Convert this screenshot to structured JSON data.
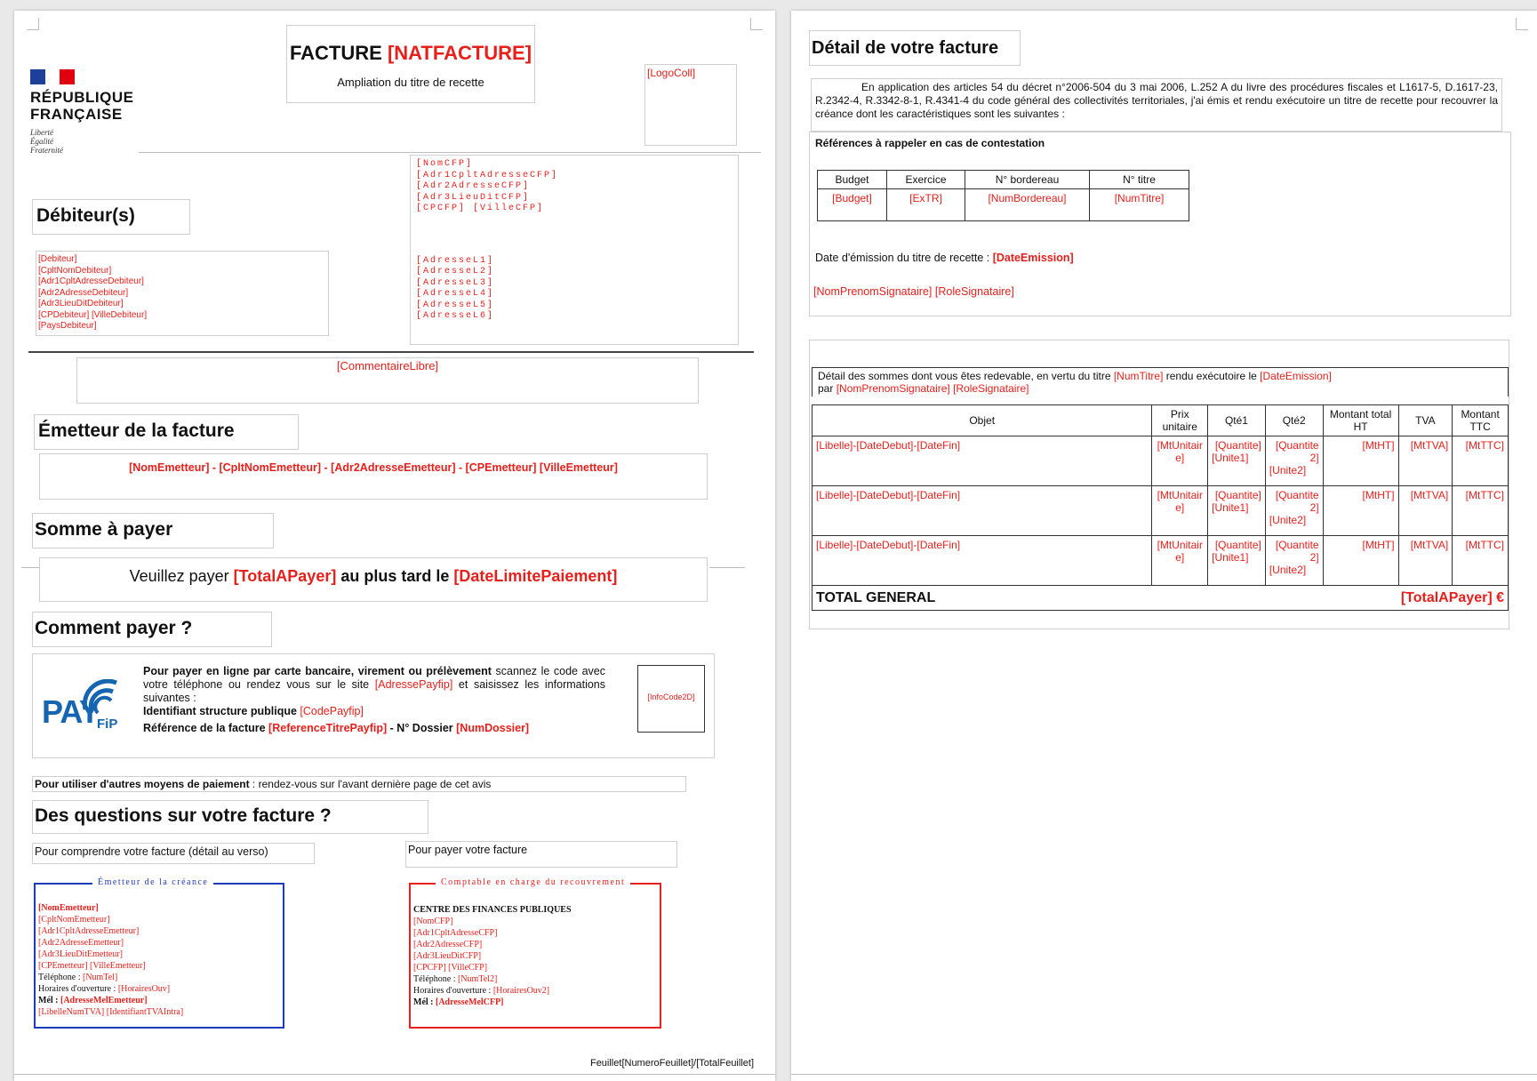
{
  "left": {
    "logo": {
      "republique": "RÉPUBLIQUE",
      "francaise": "FRANÇAISE",
      "motto": [
        "Liberté",
        "Égalité",
        "Fraternité"
      ]
    },
    "title_prefix": "FACTURE ",
    "title_field": "[NATFACTURE]",
    "title_sub": "Ampliation du titre de recette",
    "logo_coll": "[LogoColl]",
    "cfp_lines": [
      "[NomCFP]",
      "[Adr1CpltAdresseCFP]",
      "[Adr2AdresseCFP]",
      "[Adr3LieuDitCFP]",
      "[CPCFP] [VilleCFP]"
    ],
    "address_lines": [
      "[AdresseL1]",
      "[AdresseL2]",
      "[AdresseL3]",
      "[AdresseL4]",
      "[AdresseL5]",
      "[AdresseL6]"
    ],
    "debiteurs_heading": "Débiteur(s)",
    "debiteur_lines": [
      "[Debiteur]",
      "[CpltNomDebiteur]",
      "[Adr1CpltAdresseDebiteur]",
      "[Adr2AdresseDebiteur]",
      "[Adr3LieuDitDebiteur]",
      "[CPDebiteur] [VilleDebiteur]",
      "[PaysDebiteur]"
    ],
    "commentaire": "[CommentaireLibre]",
    "emetteur_heading": "Émetteur de la facture",
    "emetteur_line": "[NomEmetteur] - [CpltNomEmetteur] - [Adr2AdresseEmetteur] - [CPEmetteur] [VilleEmetteur]",
    "somme_heading": "Somme à payer",
    "somme_pre": "Veuillez payer ",
    "somme_total": "[TotalAPayer]",
    "somme_mid": " au plus tard le ",
    "somme_date": "[DateLimitePaiement]",
    "comment_heading": "Comment payer ?",
    "payfip_logo": "PAY",
    "payfip_logo_sub": "FiP",
    "payfip_text1": "Pour payer en ligne par carte bancaire, virement ou prélèvement",
    "payfip_text2": " scannez le code avec votre téléphone ou rendez vous sur le site ",
    "payfip_site": "[AdressePayfip]",
    "payfip_text3": " et saisissez les informations suivantes :",
    "payfip_id_label": "Identifiant structure publique ",
    "payfip_id": "[CodePayfip]",
    "payfip_ref_label": "Référence de la facture ",
    "payfip_ref": "[ReferenceTitrePayfip]",
    "payfip_dossier_label": " - N° Dossier ",
    "payfip_dossier": "[NumDossier]",
    "infocode": "[InfoCode2D]",
    "autres_bold": "Pour utiliser d'autres moyens de paiement",
    "autres_rest": " : rendez-vous sur l'avant dernière page de cet avis",
    "questions_heading": "Des questions sur votre facture ?",
    "comprendre": "Pour comprendre votre facture (détail au verso)",
    "payer_facture": "Pour payer votre facture",
    "emetteur_box_title": "Émetteur de la créance",
    "emetteur_box_lines": [
      "[NomEmetteur]",
      "[CpltNomEmetteur]",
      "[Adr1CpltAdresseEmetteur]",
      "[Adr2AdresseEmetteur]",
      "[Adr3LieuDitEmetteur]",
      "[CPEmetteur] [VilleEmetteur]"
    ],
    "tel_label": "Téléphone : ",
    "tel_value": "[NumTel]",
    "horaires_label": "Horaires d'ouverture : ",
    "horaires_value": "[HorairesOuv]",
    "mel_label": "Mél : ",
    "mel_value": "[AdresseMelEmetteur]",
    "tva_line": "[LibelleNumTVA] [IdentifiantTVAIntra]",
    "comptable_box_title": "Comptable en charge du recouvrement",
    "comptable_head": "CENTRE DES FINANCES PUBLIQUES",
    "comptable_lines": [
      "[NomCFP]",
      "[Adr1CpltAdresseCFP]",
      "[Adr2AdresseCFP]",
      "[Adr3LieuDitCFP]",
      "[CPCFP] [VilleCFP]"
    ],
    "tel2_value": "[NumTel2]",
    "horaires2_value": "[HorairesOuv2]",
    "mel2_value": "[AdresseMelCFP]",
    "feuillet_label": "Feuillet",
    "feuillet_value": "[NumeroFeuillet]/[TotalFeuillet]"
  },
  "right": {
    "detail_heading": "Détail de votre facture",
    "intro": "En application des articles 54 du décret n°2006-504 du 3 mai 2006, L.252 A du livre des procédures fiscales et L1617-5, D.1617-23, R.2342-4, R.3342-8-1, R.4341-4 du code général des collectivités territoriales, j'ai émis et rendu exécutoire un titre de recette pour recouvrer la créance dont les caractéristiques sont les suivantes :",
    "refs_heading": "Références à rappeler en cas de contestation",
    "refs_headers": [
      "Budget",
      "Exercice",
      "N° bordereau",
      "N° titre"
    ],
    "refs_values": [
      "[Budget]",
      "[ExTR]",
      "[NumBordereau]",
      "[NumTitre]"
    ],
    "date_emission_label": "Date d'émission du titre de recette : ",
    "date_emission_value": "[DateEmission]",
    "signataire": "[NomPrenomSignataire] [RoleSignataire]",
    "detail_intro_1": "Détail des sommes dont vous êtes redevable, en vertu du titre ",
    "detail_intro_titre": "[NumTitre]",
    "detail_intro_2": " rendu exécutoire le ",
    "detail_intro_date": "[DateEmission]",
    "detail_intro_par": "par ",
    "detail_intro_sign": "[NomPrenomSignataire] [RoleSignataire]",
    "table_headers": [
      "Objet",
      "Prix unitaire",
      "Qté1",
      "Qté2",
      "Montant total HT",
      "TVA",
      "Montant TTC"
    ],
    "rows": [
      {
        "objet": "[Libelle]-[DateDebut]-[DateFin]",
        "pu": "[MtUnitaire]",
        "q1": "[Quantite]",
        "u1": "[Unite1]",
        "q2": "[Quantite2]",
        "u2": "[Unite2]",
        "ht": "[MtHT]",
        "tva": "[MtTVA]",
        "ttc": "[MtTTC]"
      },
      {
        "objet": "[Libelle]-[DateDebut]-[DateFin]",
        "pu": "[MtUnitaire]",
        "q1": "[Quantite]",
        "u1": "[Unite1]",
        "q2": "[Quantite2]",
        "u2": "[Unite2]",
        "ht": "[MtHT]",
        "tva": "[MtTVA]",
        "ttc": "[MtTTC]"
      },
      {
        "objet": "[Libelle]-[DateDebut]-[DateFin]",
        "pu": "[MtUnitaire]",
        "q1": "[Quantite]",
        "u1": "[Unite1]",
        "q2": "[Quantite2]",
        "u2": "[Unite2]",
        "ht": "[MtHT]",
        "tva": "[MtTVA]",
        "ttc": "[MtTTC]"
      }
    ],
    "total_label": "TOTAL GENERAL",
    "total_value": "[TotalAPayer] €"
  },
  "colors": {
    "accent_red": "#e8201c",
    "blue": "#1f3bbd",
    "marianne_blue": "#1d3e99",
    "payfip_blue": "#1565b0"
  }
}
